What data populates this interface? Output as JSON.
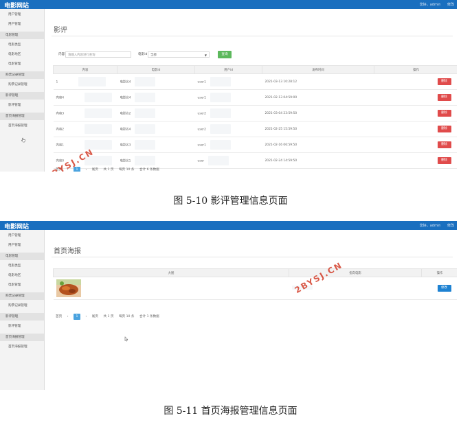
{
  "screen1": {
    "site_title": "电影网站",
    "top_right": [
      "您好，admin",
      "修改"
    ],
    "sidebar": [
      {
        "type": "item",
        "label": "用户管理"
      },
      {
        "type": "item",
        "label": "用户管理"
      },
      {
        "type": "group",
        "label": "电影管理"
      },
      {
        "type": "item",
        "label": "电影类型"
      },
      {
        "type": "item",
        "label": "电影地区"
      },
      {
        "type": "item",
        "label": "电影管理"
      },
      {
        "type": "group",
        "label": "购票记录管理"
      },
      {
        "type": "item",
        "label": "购票记录管理"
      },
      {
        "type": "group",
        "label": "影评管理"
      },
      {
        "type": "item",
        "label": "影评管理"
      },
      {
        "type": "group",
        "label": "首页海报管理"
      },
      {
        "type": "item",
        "label": "首页海报管理"
      }
    ],
    "page_title": "影评",
    "filter": {
      "content_label": "内容",
      "content_placeholder": "请输入内容进行查询",
      "movie_label": "电影id",
      "movie_value": "全部",
      "search_label": "查询"
    },
    "table": {
      "headers": [
        "内容",
        "电影id",
        "用户id",
        "发布时间",
        "操作"
      ],
      "rows": [
        [
          "1",
          "电影名4",
          "user1",
          "2021-03-13 10:28:12"
        ],
        [
          "内容4",
          "电影名4",
          "user1",
          "2021-02-13 04:59:00"
        ],
        [
          "内容3",
          "电影名2",
          "user2",
          "2021-03-04 23:59:50"
        ],
        [
          "内容2",
          "电影名4",
          "user2",
          "2021-02-25 15:59:50"
        ],
        [
          "内容1",
          "电影名3",
          "user1",
          "2021-02-16 06:59:50"
        ],
        [
          "内容0",
          "电影名1",
          "user",
          "2021-02-24 14:59:50"
        ]
      ],
      "action_label": "删除"
    },
    "pager": {
      "first": "首页",
      "prev": "‹",
      "current": "1",
      "next": "›",
      "last": "尾页",
      "total_pages": "共 1 页",
      "per_page": "每页 10 条",
      "total": "合计 6 条数据"
    },
    "watermark": "2BYSJ.CN"
  },
  "caption1": "图 5-10 影评管理信息页面",
  "screen2": {
    "site_title": "电影网站",
    "top_right": [
      "您好，admin",
      "修改"
    ],
    "page_title": "首页海报",
    "table": {
      "headers": [
        "大图",
        "指向电影",
        "操作"
      ],
      "rows": [
        [
          "",
          "",
          "修改"
        ]
      ]
    },
    "pager": {
      "first": "首页",
      "prev": "‹",
      "current": "1",
      "next": "›",
      "last": "尾页",
      "total_pages": "共 1 页",
      "per_page": "每页 10 条",
      "total": "合计 1 条数据"
    },
    "watermark": "2BYSJ.CN"
  },
  "caption2": "图 5-11 首页海报管理信息页面",
  "colors": {
    "topbar": "#1a6fbf",
    "delete": "#e04b4b",
    "edit": "#1e82d2",
    "search": "#5cb85c",
    "watermark": "#d23c28"
  }
}
